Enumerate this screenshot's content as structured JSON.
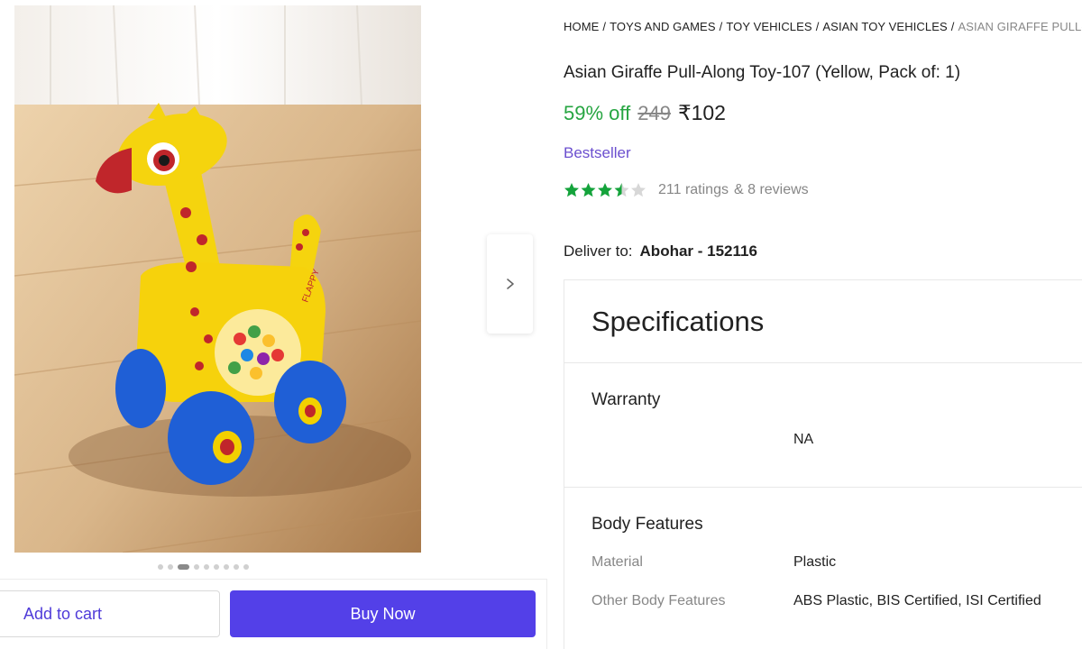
{
  "breadcrumb": [
    {
      "label": "HOME"
    },
    {
      "label": "TOYS AND GAMES"
    },
    {
      "label": "TOY VEHICLES"
    },
    {
      "label": "ASIAN TOY VEHICLES"
    },
    {
      "label": "ASIAN GIRAFFE PULL-ALO"
    }
  ],
  "breadcrumb_sep": "/",
  "product": {
    "title": "Asian Giraffe Pull-Along Toy-107 (Yellow, Pack of: 1)",
    "discount": "59% off",
    "mrp": "249",
    "price": "₹102",
    "badge": "Bestseller",
    "rating_value": 3.5,
    "ratings": "211 ratings",
    "reviews": "& 8 reviews",
    "toy_label": "FLAPPY"
  },
  "delivery": {
    "label": "Deliver to:",
    "location": "Abohar - 152116"
  },
  "gallery": {
    "total_images": 9,
    "active_index": 2,
    "next_icon": "chevron-right-icon"
  },
  "actions": {
    "add_to_cart": "Add to cart",
    "buy_now": "Buy Now"
  },
  "specifications": {
    "heading": "Specifications",
    "warranty": {
      "title": "Warranty",
      "value": "NA"
    },
    "body_features": {
      "title": "Body Features",
      "rows": [
        {
          "key": "Material",
          "value": "Plastic"
        },
        {
          "key": "Other Body Features",
          "value": "ABS Plastic, BIS Certified, ISI Certified"
        }
      ]
    }
  },
  "colors": {
    "accent": "#5340e8",
    "discount": "#26a541",
    "bestseller": "#6b4fcf",
    "star": "#14a33b",
    "muted": "#878787"
  }
}
